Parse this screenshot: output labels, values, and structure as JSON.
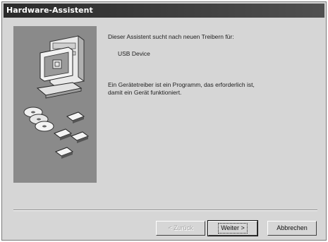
{
  "window": {
    "title": "Hardware-Assistent"
  },
  "content": {
    "intro": "Dieser Assistent sucht nach neuen Treibern für:",
    "device_name": "USB Device",
    "description_line1": "Ein Gerätetreiber ist ein Programm, das erforderlich ist,",
    "description_line2": "damit ein Gerät funktioniert."
  },
  "buttons": {
    "back": "< Zurück",
    "next": "Weiter >",
    "cancel": "Abbrechen"
  }
}
